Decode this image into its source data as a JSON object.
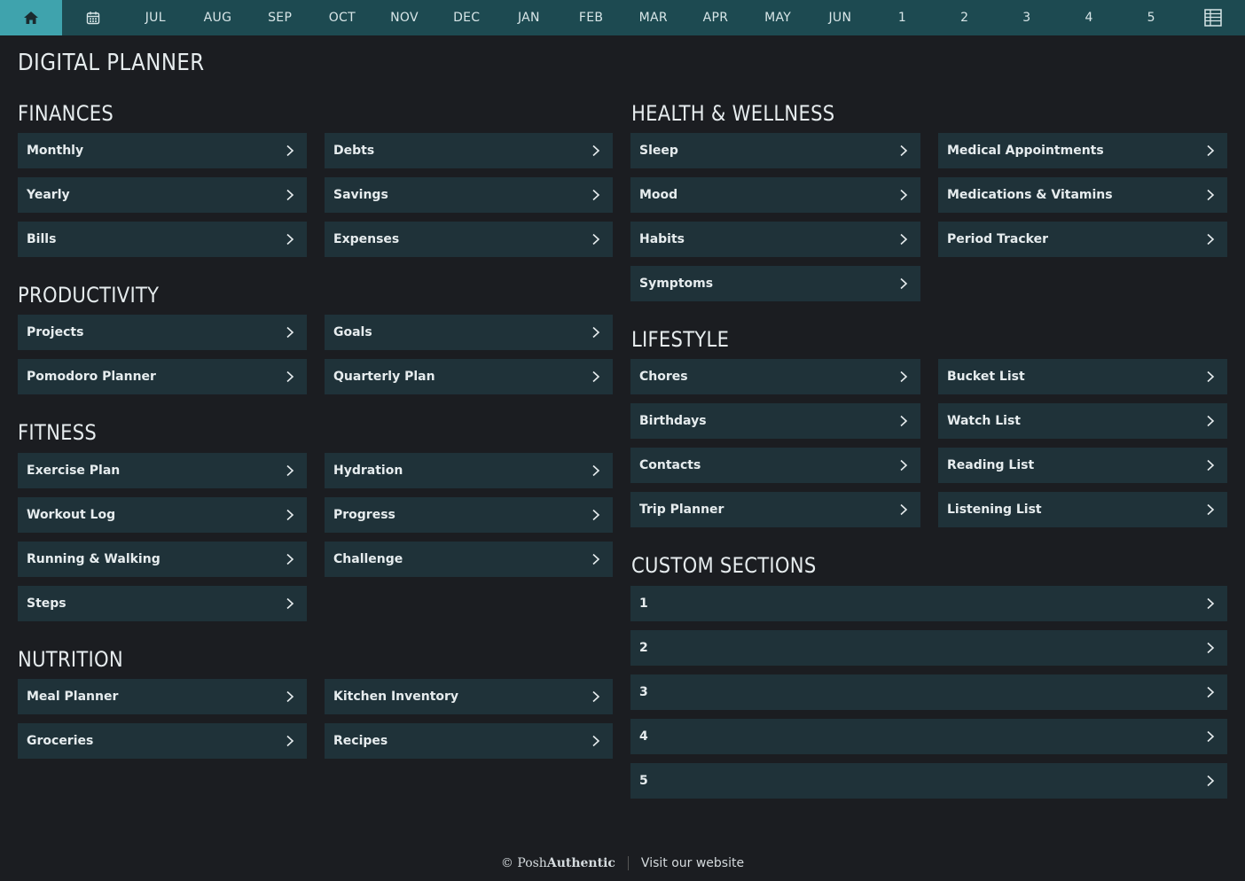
{
  "nav": {
    "home_icon": "home-icon",
    "calendar_icon": "calendar-icon",
    "table_icon": "table-icon",
    "items": [
      "JUL",
      "AUG",
      "SEP",
      "OCT",
      "NOV",
      "DEC",
      "JAN",
      "FEB",
      "MAR",
      "APR",
      "MAY",
      "JUN",
      "1",
      "2",
      "3",
      "4",
      "5"
    ]
  },
  "title": "DIGITAL PLANNER",
  "sections": {
    "finances": {
      "title": "FINANCES",
      "items": [
        "Monthly",
        "Debts",
        "Yearly",
        "Savings",
        "Bills",
        "Expenses"
      ]
    },
    "productivity": {
      "title": "PRODUCTIVITY",
      "items": [
        "Projects",
        "Goals",
        "Pomodoro Planner",
        "Quarterly Plan"
      ]
    },
    "fitness": {
      "title": "FITNESS",
      "items": [
        "Exercise Plan",
        "Hydration",
        "Workout Log",
        "Progress",
        "Running & Walking",
        "Challenge",
        "Steps"
      ]
    },
    "nutrition": {
      "title": "NUTRITION",
      "items": [
        "Meal Planner",
        "Kitchen Inventory",
        "Groceries",
        "Recipes"
      ]
    },
    "health": {
      "title": "HEALTH & WELLNESS",
      "items": [
        "Sleep",
        "Medical Appointments",
        "Mood",
        "Medications & Vitamins",
        "Habits",
        "Period Tracker",
        "Symptoms"
      ]
    },
    "lifestyle": {
      "title": "LIFESTYLE",
      "items": [
        "Chores",
        "Bucket List",
        "Birthdays",
        "Watch List",
        "Contacts",
        "Reading List",
        "Trip Planner",
        "Listening List"
      ]
    },
    "custom": {
      "title": "CUSTOM SECTIONS",
      "items": [
        "1",
        "2",
        "3",
        "4",
        "5"
      ]
    }
  },
  "footer": {
    "copyright": "©",
    "brand_light": "Posh",
    "brand_bold": "Authentic",
    "link": "Visit our website"
  },
  "colors": {
    "nav_bg": "#1d4a51",
    "home_active": "#3fa3ad",
    "item_bg": "#1f3239",
    "page_bg": "#1b1d21"
  }
}
